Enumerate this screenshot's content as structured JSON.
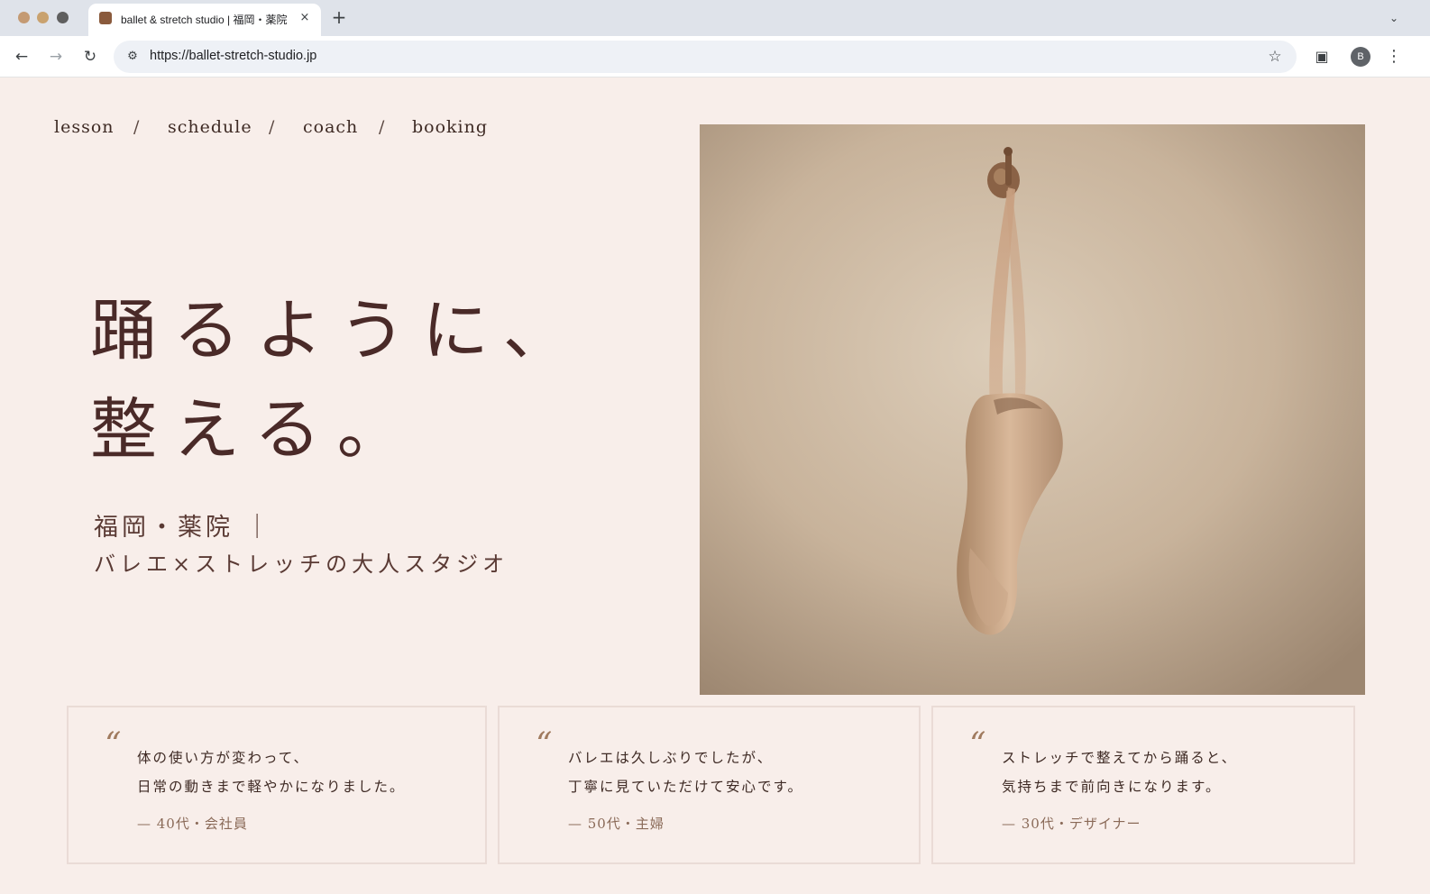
{
  "browser": {
    "tab_title": "ballet & stretch studio | 福岡・薬院",
    "url": "https://ballet-stretch-studio.jp",
    "profile_initial": "B",
    "icons": {
      "close": "×",
      "new_tab": "+",
      "tabs_menu": "⌄",
      "back": "←",
      "forward": "→",
      "reload": "↻",
      "site_info": "⚙",
      "bookmark": "☆",
      "side_panel": "▣",
      "menu": "⋮"
    },
    "traffic_colors": [
      "#c49a73",
      "#c9a26f",
      "#5f5f5f"
    ]
  },
  "nav": {
    "items": [
      "lesson",
      "schedule",
      "coach",
      "booking"
    ],
    "separator": "/"
  },
  "hero": {
    "title_line1": "踊るように、",
    "title_line2": "整える。",
    "subtitle_line1": "福岡・薬院 ｜",
    "subtitle_line2": "バレエ×ストレッチの大人スタジオ"
  },
  "testimonials": [
    {
      "line1": "体の使い方が変わって、",
      "line2": "日常の動きまで軽やかになりました。",
      "author": "— 40代・会社員"
    },
    {
      "line1": "バレエは久しぶりでしたが、",
      "line2": "丁寧に見ていただけて安心です。",
      "author": "— 50代・主婦"
    },
    {
      "line1": "ストレッチで整えてから踊ると、",
      "line2": "気持ちまで前向きになります。",
      "author": "— 30代・デザイナー"
    }
  ],
  "quote_glyph": "“",
  "colors": {
    "page_bg": "#f8eeea",
    "heading": "#4a2a28",
    "accent": "#a07a5e",
    "card_border": "#eadbd6"
  }
}
